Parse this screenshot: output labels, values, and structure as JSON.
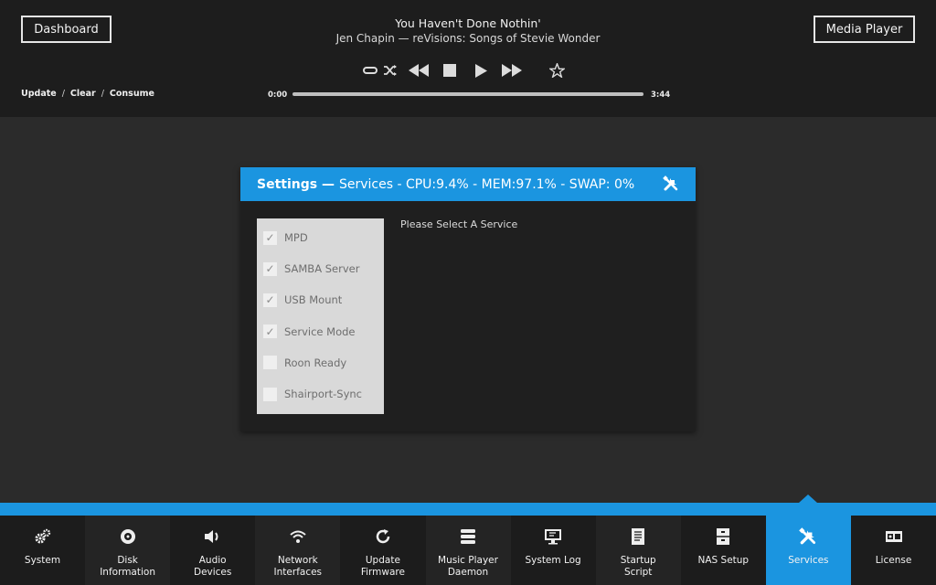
{
  "header": {
    "left_button": "Dashboard",
    "right_button": "Media Player",
    "track_title": "You Haven't Done Nothin'",
    "track_subtitle": "Jen Chapin — reVisions: Songs of Stevie Wonder",
    "links": [
      "Update",
      "Clear",
      "Consume"
    ],
    "time_elapsed": "0:00",
    "time_total": "3:44",
    "progress_fraction": 0.0,
    "controls": [
      "repeat-icon",
      "shuffle-icon",
      "previous-icon",
      "stop-icon",
      "play-icon",
      "next-icon",
      "favorite-star-icon"
    ]
  },
  "panel": {
    "title_bold": "Settings —",
    "title_rest": "Services - CPU:9.4% - MEM:97.1% - SWAP: 0%",
    "hint": "Please Select A Service",
    "services": [
      {
        "label": "MPD",
        "checked": true
      },
      {
        "label": "SAMBA Server",
        "checked": true
      },
      {
        "label": "USB Mount",
        "checked": true
      },
      {
        "label": "Service Mode",
        "checked": true
      },
      {
        "label": "Roon Ready",
        "checked": false
      },
      {
        "label": "Shairport-Sync",
        "checked": false
      }
    ]
  },
  "tabs": [
    {
      "label": "System",
      "icon": "gears-icon"
    },
    {
      "label": "Disk\nInformation",
      "icon": "disk-icon"
    },
    {
      "label": "Audio\nDevices",
      "icon": "speaker-icon"
    },
    {
      "label": "Network\nInterfaces",
      "icon": "wifi-icon"
    },
    {
      "label": "Update\nFirmware",
      "icon": "refresh-icon"
    },
    {
      "label": "Music Player\nDaemon",
      "icon": "database-icon"
    },
    {
      "label": "System Log",
      "icon": "monitor-icon"
    },
    {
      "label": "Startup\nScript",
      "icon": "document-icon"
    },
    {
      "label": "NAS Setup",
      "icon": "cabinet-icon"
    },
    {
      "label": "Services",
      "icon": "tools-icon",
      "active": true
    },
    {
      "label": "License",
      "icon": "license-icon"
    }
  ],
  "colors": {
    "accent": "#1b95e0",
    "topbar": "#1d1d1d",
    "background": "#2b2b2b"
  }
}
